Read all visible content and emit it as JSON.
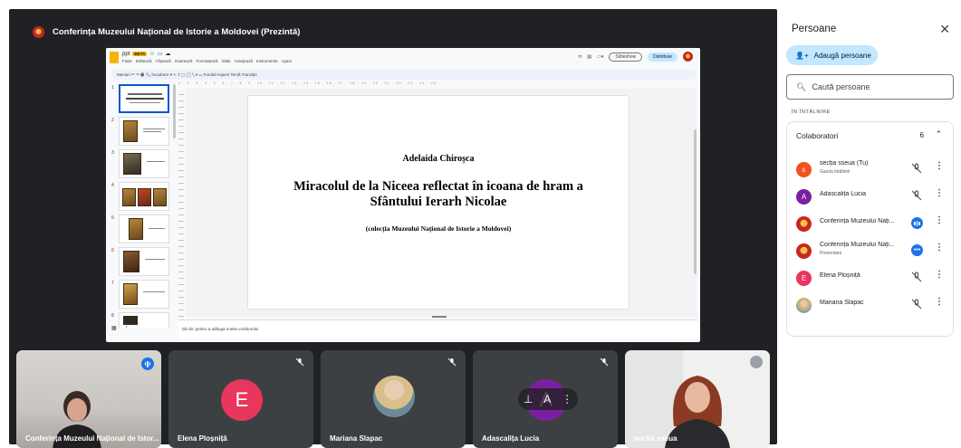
{
  "meeting": {
    "title": "Conferința Muzeului Național de Istorie a Moldovei (Prezintă)"
  },
  "presentation": {
    "doc_name": "ppt",
    "badge": "BETA",
    "menu": [
      "Fișier",
      "Editează",
      "Afișează",
      "Inserează",
      "Formatează",
      "Slide",
      "Aranjează",
      "Instrumente",
      "Ajutor"
    ],
    "slideshow_label": "Slideshow",
    "share_label": "Distribuie",
    "tools_text": "Meniuri   ↶  ↷  🖶  🔍   Încadrare  ▾   ↖  T  ▢  ◯  ╲  ▾   ▭   Fundal   Aspect   Temă   Tranziție",
    "ruler": "1 . 2 . 3 . 4 . 5 . 6 . 7 . 8 . 9 . 10 . 11 . 12 . 13 . 14 . 15 . 16 . 17 . 18 . 19 . 20 . 21 . 22 . 23 . 24 . 25",
    "slide": {
      "author": "Adelaida Chiroșca",
      "title": "Miracolul de la Niceea reflectat în icoana de hram a Sfântului Ierarh Nicolae",
      "subtitle": "(colecția Muzeului Național de Istorie a Moldovei)"
    },
    "notes_placeholder": "Dă clic pentru a adăuga notele vorbitorului",
    "thumbnail_numbers": [
      "1",
      "2",
      "3",
      "4",
      "5",
      "6",
      "7",
      "8"
    ]
  },
  "tiles": [
    {
      "name": "Conferința Muzeului Național de Istor..."
    },
    {
      "name": "Elena Ploșniță",
      "initial": "E",
      "color": "#e8365d"
    },
    {
      "name": "Mariana Slapac"
    },
    {
      "name": "Adascalița Lucia",
      "initial": "A",
      "color": "#7b1fa2"
    },
    {
      "name": "secția sseua"
    }
  ],
  "people_panel": {
    "title": "Persoane",
    "add_label": "Adaugă persoane",
    "search_placeholder": "Caută persoane",
    "section_label": "ÎN ÎNTÂLNIRE",
    "group_name": "Colaboratori",
    "group_count": "6",
    "participants": [
      {
        "name": "secția sseua (Tu)",
        "sub": "Gazda întâlnirii",
        "initial": "s",
        "color": "#f4511e",
        "status": "muted"
      },
      {
        "name": "Adascalița Lucia",
        "initial": "A",
        "color": "#7b1fa2",
        "status": "muted"
      },
      {
        "name": "Conferința Muzeului Nați...",
        "status": "speaking"
      },
      {
        "name": "Conferința Muzeului Nați...",
        "sub": "Prezentare",
        "status": "presenting"
      },
      {
        "name": "Elena Ploșniță",
        "initial": "E",
        "color": "#e8365d",
        "status": "muted"
      },
      {
        "name": "Mariana Slapac",
        "status": "muted"
      }
    ]
  },
  "colors": {
    "meet_bg": "#202124",
    "tile_bg": "#3c4043",
    "accent": "#1a73e8",
    "add_button": "#c2e7ff"
  }
}
